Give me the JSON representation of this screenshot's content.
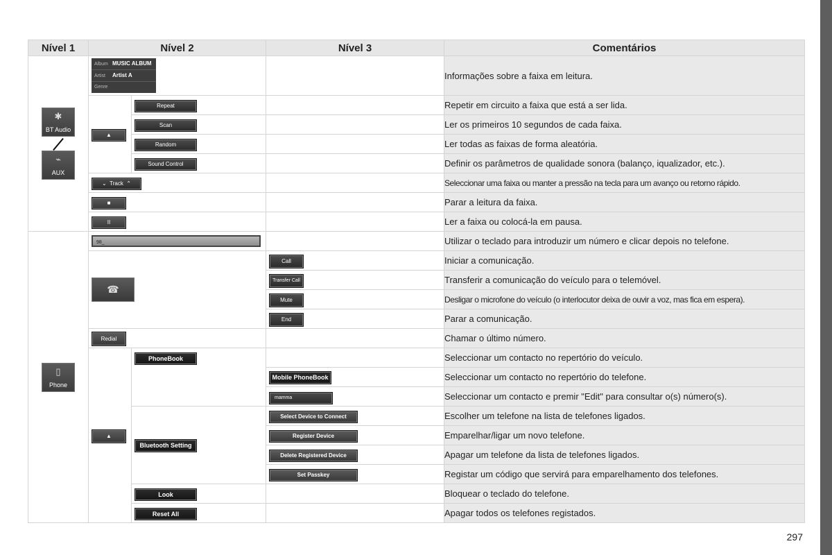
{
  "headers": [
    "Nível 1",
    "Nível 2",
    "Nível 3",
    "Comentários"
  ],
  "level1": {
    "bt_audio": {
      "label": "BT Audio",
      "icon": "bluetooth-icon"
    },
    "aux": {
      "label": "AUX",
      "icon": "aux-cable-icon"
    },
    "phone": {
      "label": "Phone",
      "icon": "mobile-phone-icon"
    }
  },
  "info_panel": {
    "album_key": "Album",
    "album_value": "MUSIC ALBUM",
    "artist_key": "Artist",
    "artist_value": "Artist A",
    "genre_key": "Genre"
  },
  "audio": {
    "up_button": "▲",
    "repeat": "Repeat",
    "scan": "Scan",
    "random": "Random",
    "sound_control": "Sound Control",
    "track_prev": "⌄",
    "track": "Track",
    "track_next": "⌃",
    "stop": "■",
    "pause": "II"
  },
  "phone": {
    "number_field": "98_",
    "call_icon": "☎",
    "call": "Call",
    "transfer_call": "Transfer Call",
    "mute": "Mute",
    "end": "End",
    "redial": "Redial",
    "up_button": "▲",
    "phonebook": "PhoneBook",
    "mobile_phonebook": "Mobile PhoneBook",
    "contact": "mamma",
    "bluetooth_setting": "Bluetooth Setting",
    "select_device": "Select Device to  Connect",
    "register_device": "Register Device",
    "delete_device": "Delete Registered Device",
    "set_passkey": "Set Passkey",
    "lock": "Look",
    "reset_all": "Reset All"
  },
  "comments": [
    "Informações sobre a faixa em leitura.",
    "Repetir em circuito a faixa que está a ser lida.",
    "Ler os primeiros 10 segundos de cada faixa.",
    "Ler todas as faixas de forma aleatória.",
    "Definir os parâmetros de qualidade sonora (balanço, iqualizador, etc.).",
    "Seleccionar uma faixa ou manter a pressão na tecla para um avanço ou retorno rápido.",
    "Parar a leitura da faixa.",
    "Ler a faixa ou colocá-la em pausa.",
    "Utilizar o teclado para introduzir um número e clicar depois no telefone.",
    "Iniciar a comunicação.",
    "Transferir a comunicação do veículo para o telemóvel.",
    "Desligar o microfone do veículo (o interlocutor deixa de ouvir a voz, mas fica em espera).",
    "Parar a comunicação.",
    "Chamar o último número.",
    "Seleccionar um contacto no repertório do veículo.",
    "Seleccionar um contacto no repertório do telefone.",
    "Seleccionar um contacto e premir \"Edit\" para consultar o(s) número(s).",
    "Escolher um telefone na lista de telefones ligados.",
    "Emparelhar/ligar um novo telefone.",
    "Apagar um telefone da lista de telefones ligados.",
    "Registar um código que servirá para emparelhamento dos telefones.",
    "Bloquear o teclado do telefone.",
    "Apagar todos os telefones registados."
  ],
  "page_number": "297"
}
